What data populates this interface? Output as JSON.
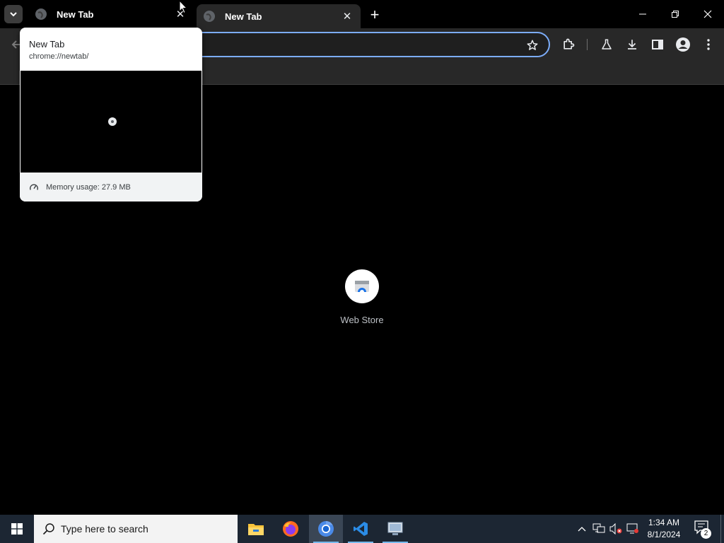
{
  "browser": {
    "tabs": [
      {
        "title": "New Tab"
      },
      {
        "title": "New Tab"
      }
    ],
    "new_tab_symbol": "+",
    "hover_card": {
      "title": "New Tab",
      "url": "chrome://newtab/",
      "memory": "Memory usage: 27.9 MB"
    },
    "omnibox": {
      "value": ""
    },
    "shortcuts": [
      {
        "label": "Web Store",
        "icon": "web-store-icon"
      }
    ],
    "colors": {
      "accent": "#7cacf8",
      "toolbar": "#282828",
      "page": "#000000"
    }
  },
  "taskbar": {
    "search_placeholder": "Type here to search",
    "apps": [
      "file-explorer-icon",
      "firefox-icon",
      "chrome-icon",
      "vscode-icon",
      "remote-desktop-icon"
    ],
    "clock": {
      "time": "1:34 AM",
      "date": "8/1/2024"
    },
    "notifications": "2"
  }
}
